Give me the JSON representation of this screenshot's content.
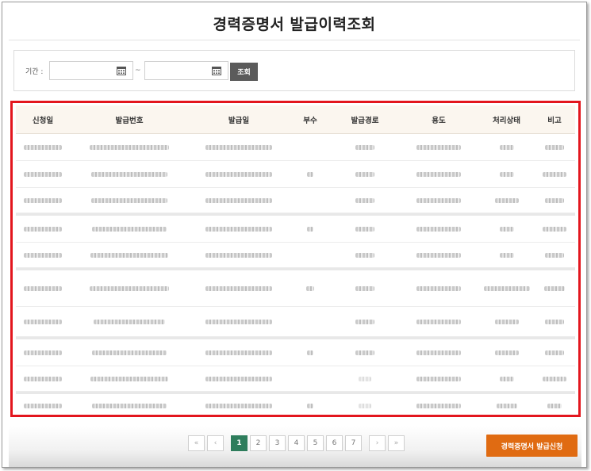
{
  "page": {
    "title": "경력증명서 발급이력조회"
  },
  "search": {
    "period_label": "기간 :",
    "start_value": "",
    "end_value": "",
    "separator": "~",
    "button_label": "조회"
  },
  "table": {
    "headers": [
      "신청일",
      "발급번호",
      "발급일",
      "부수",
      "발급경로",
      "용도",
      "처리상태",
      "비고"
    ],
    "note": "all cell values are pixelated/obscured in the screenshot"
  },
  "pagination": {
    "first": "«",
    "prev": "‹",
    "pages": [
      "1",
      "2",
      "3",
      "4",
      "5",
      "6",
      "7"
    ],
    "current": "1",
    "next": "›",
    "last": "»"
  },
  "actions": {
    "apply_label": "경력증명서 발급신청"
  },
  "colors": {
    "highlight": "#e3161e",
    "active_page": "#2e7d5c",
    "apply_button": "#e06b12",
    "search_button": "#5b5b5b"
  }
}
